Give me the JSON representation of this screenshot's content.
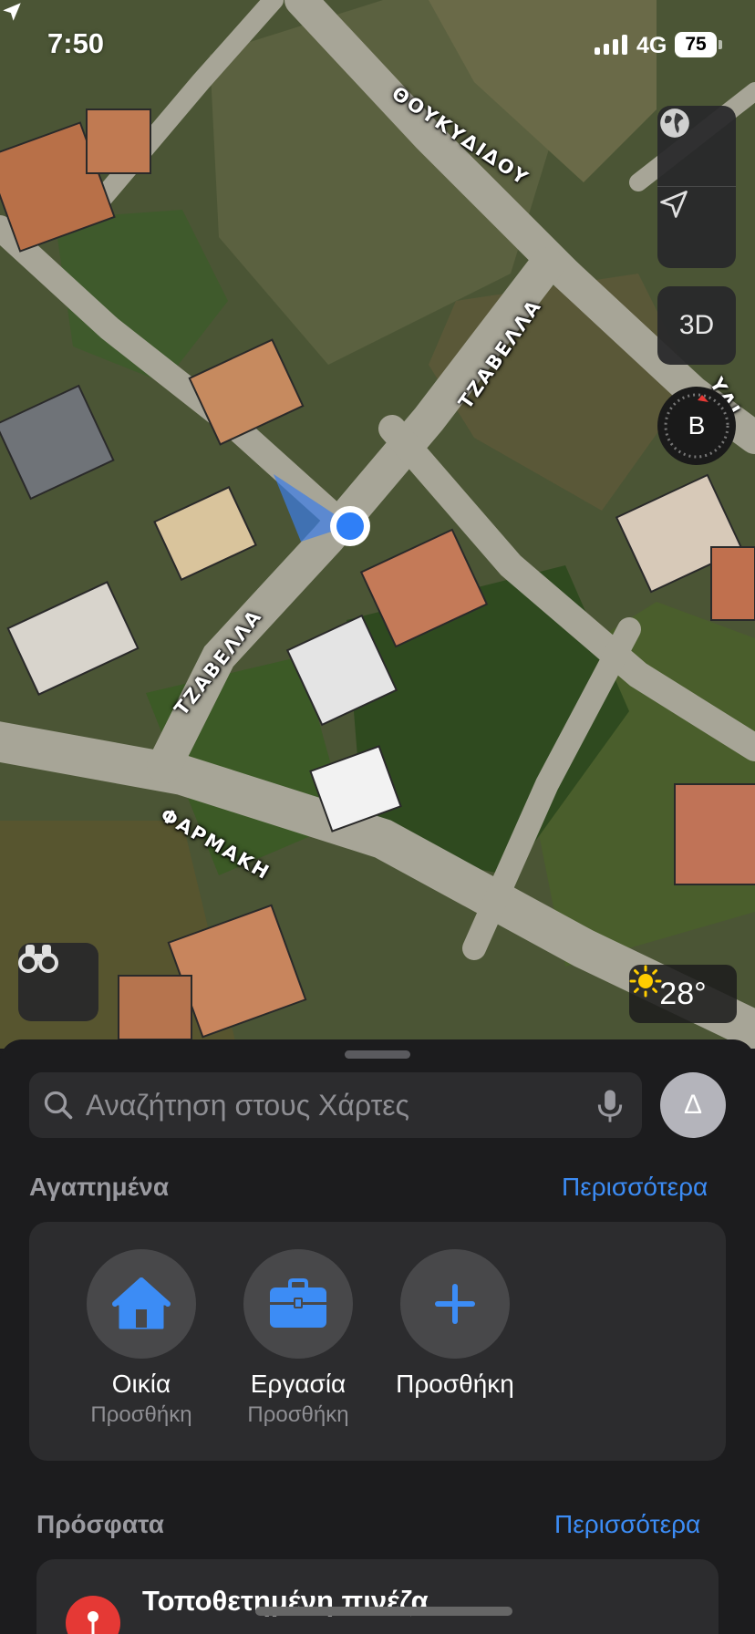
{
  "status_bar": {
    "time": "7:50",
    "network": "4G",
    "battery": "75"
  },
  "map": {
    "streets": [
      "ΘΟΥΚΥΔΙΔΟΥ",
      "ΤΖΑΒΕΛΛΑ",
      "ΤΖΑΒΕΛΛΑ",
      "ΦΑΡΜΑΚΗ",
      "ΥΔΙ"
    ],
    "controls": {
      "globe_icon": "globe-icon",
      "location_icon": "location-arrow-icon",
      "view_3d_label": "3D",
      "compass_letter": "Β"
    },
    "weather": {
      "icon": "sun-icon",
      "temperature": "28°"
    },
    "lookaround_icon": "binoculars-icon"
  },
  "sheet": {
    "search": {
      "placeholder": "Αναζήτηση στους Χάρτες"
    },
    "avatar_initial": "Δ",
    "favorites": {
      "title": "Αγαπημένα",
      "more": "Περισσότερα",
      "items": [
        {
          "icon": "house-icon",
          "label": "Οικία",
          "sublabel": "Προσθήκη"
        },
        {
          "icon": "briefcase-icon",
          "label": "Εργασία",
          "sublabel": "Προσθήκη"
        },
        {
          "icon": "plus-icon",
          "label": "Προσθήκη",
          "sublabel": ""
        }
      ]
    },
    "recents": {
      "title": "Πρόσφατα",
      "more": "Περισσότερα",
      "items": [
        {
          "icon": "pin-icon",
          "title": "Τοποθετημένη πινέζα"
        }
      ]
    }
  },
  "colors": {
    "accent": "#3c8cf5",
    "sheet_bg": "#1c1c1e",
    "card_bg": "#2c2c2e",
    "location_dot": "#2f7ff7",
    "pin": "#e53935"
  }
}
